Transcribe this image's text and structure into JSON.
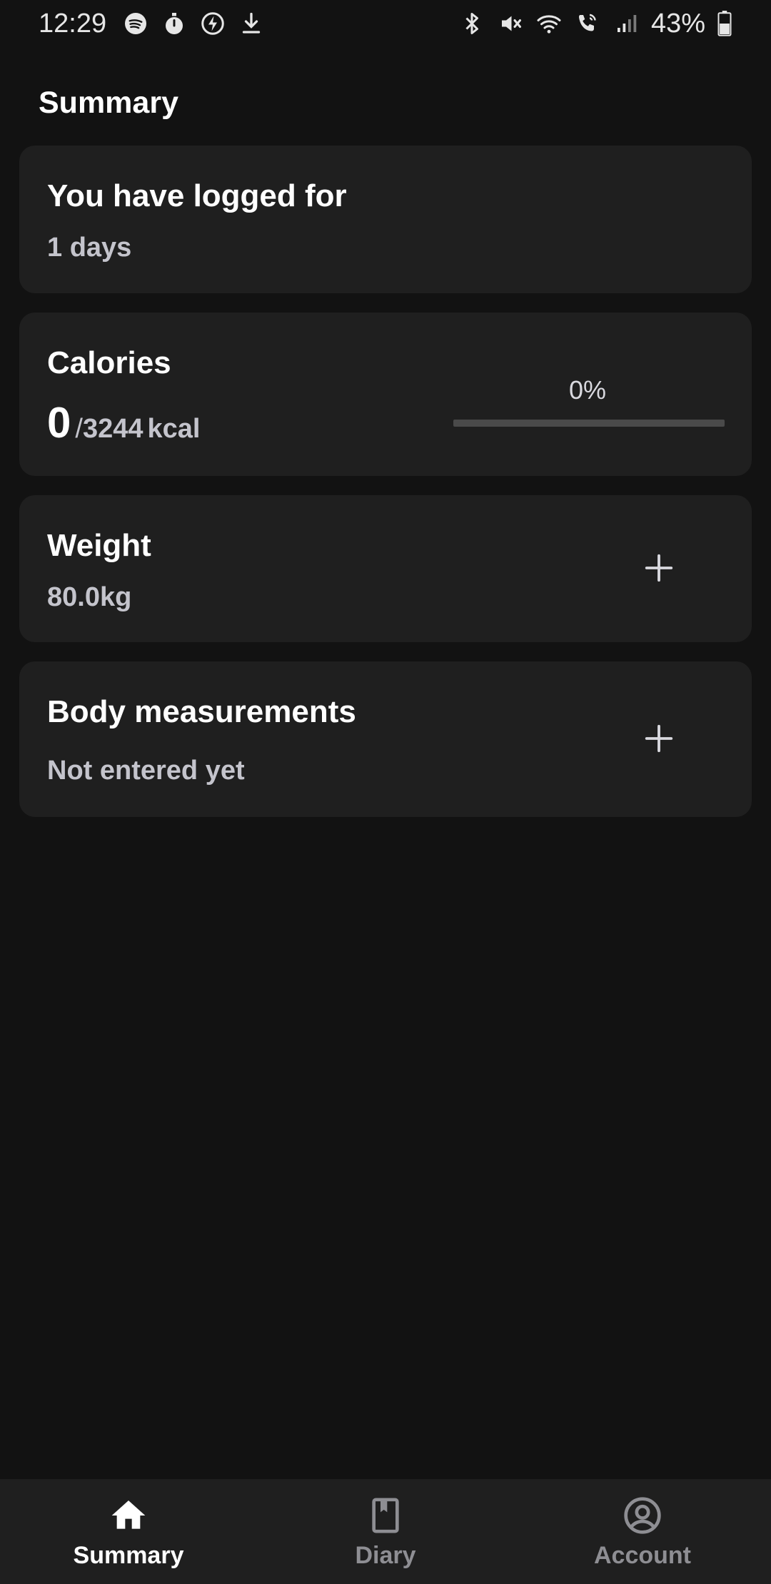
{
  "status_bar": {
    "time": "12:29",
    "battery": "43%",
    "left_icons": [
      "spotify-icon",
      "timer-icon",
      "flash-icon",
      "download-icon"
    ],
    "right_icons": [
      "bluetooth-icon",
      "mute-icon",
      "wifi-icon",
      "wifi-call-icon",
      "signal-icon",
      "battery-icon"
    ]
  },
  "page": {
    "title": "Summary"
  },
  "logged_card": {
    "title": "You have logged for",
    "value": "1 days"
  },
  "calories_card": {
    "title": "Calories",
    "consumed": "0",
    "separator": "/",
    "goal": "3244",
    "unit": "kcal",
    "progress_label": "0%",
    "progress_fraction": 0
  },
  "weight_card": {
    "title": "Weight",
    "value": "80.0kg",
    "action_icon": "plus-icon"
  },
  "body_card": {
    "title": "Body measurements",
    "value": "Not entered yet",
    "action_icon": "plus-icon"
  },
  "bottom_nav": {
    "items": [
      {
        "label": "Summary",
        "icon": "home-icon",
        "active": true
      },
      {
        "label": "Diary",
        "icon": "book-icon",
        "active": false
      },
      {
        "label": "Account",
        "icon": "account-icon",
        "active": false
      }
    ]
  },
  "colors": {
    "background": "#121212",
    "card": "#1f1f1f",
    "text_primary": "#ffffff",
    "text_secondary": "#c4c4cc",
    "nav_inactive": "#8e8e93",
    "progress_track": "#4a4a4a"
  }
}
